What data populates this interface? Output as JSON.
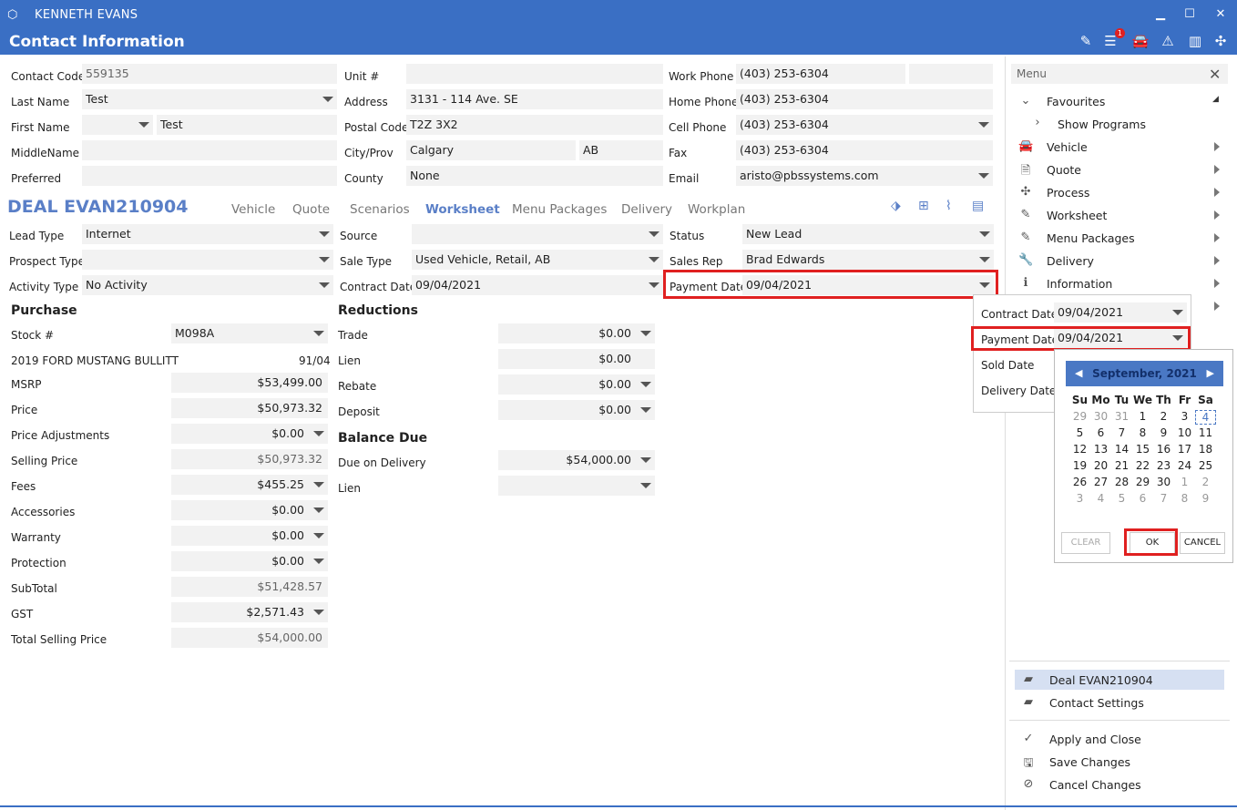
{
  "window": {
    "title": "KENNETH EVANS",
    "page_title": "Contact Information",
    "notification_count": "1"
  },
  "contact": {
    "contact_code_label": "Contact Code",
    "contact_code": "559135",
    "last_name_label": "Last Name",
    "last_name": "Test",
    "first_name_label": "First Name",
    "first_name": "Test",
    "middle_name_label": "MiddleName",
    "preferred_label": "Preferred",
    "unit_label": "Unit #",
    "address_label": "Address",
    "address": "3131 - 114 Ave. SE",
    "postal_label": "Postal Code",
    "postal": "T2Z 3X2",
    "cityprov_label": "City/Prov",
    "city": "Calgary",
    "prov": "AB",
    "county_label": "County",
    "county": "None",
    "work_phone_label": "Work Phone",
    "work_phone": "(403) 253-6304",
    "home_phone_label": "Home Phone",
    "home_phone": "(403) 253-6304",
    "cell_phone_label": "Cell Phone",
    "cell_phone": "(403) 253-6304",
    "fax_label": "Fax",
    "fax": "(403) 253-6304",
    "email_label": "Email",
    "email": "aristo@pbssystems.com"
  },
  "deal": {
    "title": "DEAL EVAN210904",
    "tabs": [
      "Vehicle",
      "Quote",
      "Scenarios",
      "Worksheet",
      "Menu Packages",
      "Delivery",
      "Workplan"
    ],
    "active_tab": "Worksheet",
    "lead_type_label": "Lead Type",
    "lead_type": "Internet",
    "prospect_type_label": "Prospect Type",
    "activity_type_label": "Activity Type",
    "activity_type": "No Activity",
    "source_label": "Source",
    "sale_type_label": "Sale Type",
    "sale_type": "Used Vehicle, Retail, AB",
    "contract_date_label": "Contract Date",
    "contract_date": "09/04/2021",
    "status_label": "Status",
    "status": "New Lead",
    "sales_rep_label": "Sales Rep",
    "sales_rep": "Brad Edwards",
    "payment_date_label": "Payment Date",
    "payment_date": "09/04/2021"
  },
  "purchase": {
    "heading": "Purchase",
    "stock_label": "Stock #",
    "stock": "M098A",
    "vehicle": "2019 FORD MUSTANG BULLITT",
    "vehicle_code": "91/04",
    "msrp_label": "MSRP",
    "msrp": "$53,499.00",
    "price_label": "Price",
    "price": "$50,973.32",
    "price_adj_label": "Price Adjustments",
    "price_adj": "$0.00",
    "selling_price_label": "Selling Price",
    "selling_price": "$50,973.32",
    "fees_label": "Fees",
    "fees": "$455.25",
    "accessories_label": "Accessories",
    "accessories": "$0.00",
    "warranty_label": "Warranty",
    "warranty": "$0.00",
    "protection_label": "Protection",
    "protection": "$0.00",
    "subtotal_label": "SubTotal",
    "subtotal": "$51,428.57",
    "gst_label": "GST",
    "gst": "$2,571.43",
    "total_label": "Total Selling Price",
    "total": "$54,000.00"
  },
  "reductions": {
    "heading": "Reductions",
    "trade_label": "Trade",
    "trade": "$0.00",
    "lien_label": "Lien",
    "lien": "$0.00",
    "rebate_label": "Rebate",
    "rebate": "$0.00",
    "deposit_label": "Deposit",
    "deposit": "$0.00"
  },
  "balance": {
    "heading": "Balance Due",
    "due_label": "Due on Delivery",
    "due": "$54,000.00",
    "lien_label": "Lien"
  },
  "menu": {
    "header": "Menu",
    "favourites": "Favourites",
    "show_programs": "Show Programs",
    "items": [
      "Vehicle",
      "Quote",
      "Process",
      "Worksheet",
      "Menu Packages",
      "Delivery",
      "Information"
    ],
    "deal_link": "Deal EVAN210904",
    "contact_settings": "Contact Settings",
    "apply_close": "Apply and Close",
    "save_changes": "Save Changes",
    "cancel_changes": "Cancel Changes"
  },
  "popup": {
    "contract_date_label": "Contract Date",
    "contract_date": "09/04/2021",
    "payment_date_label": "Payment Date",
    "payment_date": "09/04/2021",
    "sold_date_label": "Sold Date",
    "delivery_date_label": "Delivery Date"
  },
  "calendar": {
    "month": "September, 2021",
    "dow": [
      "Su",
      "Mo",
      "Tu",
      "We",
      "Th",
      "Fr",
      "Sa"
    ],
    "weeks": [
      [
        "29",
        "30",
        "31",
        "1",
        "2",
        "3",
        "4"
      ],
      [
        "5",
        "6",
        "7",
        "8",
        "9",
        "10",
        "11"
      ],
      [
        "12",
        "13",
        "14",
        "15",
        "16",
        "17",
        "18"
      ],
      [
        "19",
        "20",
        "21",
        "22",
        "23",
        "24",
        "25"
      ],
      [
        "26",
        "27",
        "28",
        "29",
        "30",
        "1",
        "2"
      ],
      [
        "3",
        "4",
        "5",
        "6",
        "7",
        "8",
        "9"
      ]
    ],
    "clear": "CLEAR",
    "ok": "OK",
    "cancel": "CANCEL"
  }
}
